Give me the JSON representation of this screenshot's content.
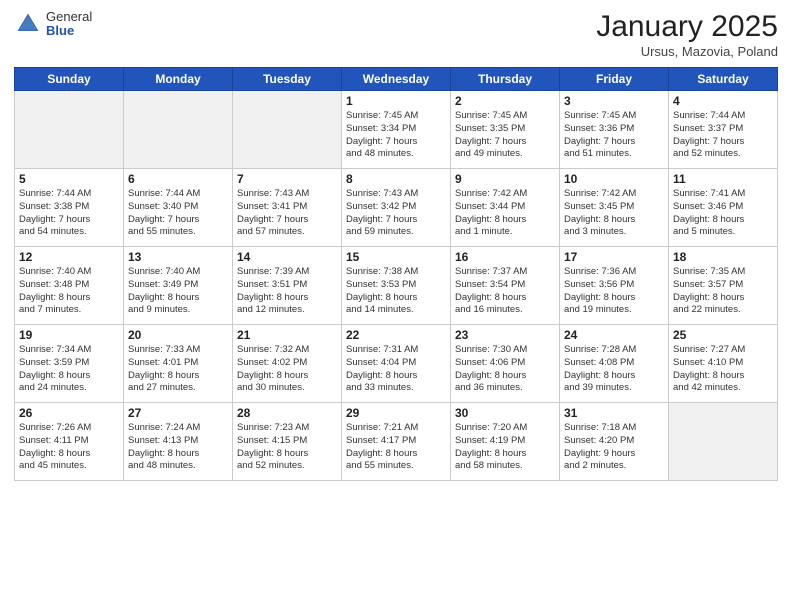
{
  "header": {
    "logo_general": "General",
    "logo_blue": "Blue",
    "month_title": "January 2025",
    "location": "Ursus, Mazovia, Poland"
  },
  "weekdays": [
    "Sunday",
    "Monday",
    "Tuesday",
    "Wednesday",
    "Thursday",
    "Friday",
    "Saturday"
  ],
  "weeks": [
    [
      {
        "day": "",
        "info": ""
      },
      {
        "day": "",
        "info": ""
      },
      {
        "day": "",
        "info": ""
      },
      {
        "day": "1",
        "info": "Sunrise: 7:45 AM\nSunset: 3:34 PM\nDaylight: 7 hours\nand 48 minutes."
      },
      {
        "day": "2",
        "info": "Sunrise: 7:45 AM\nSunset: 3:35 PM\nDaylight: 7 hours\nand 49 minutes."
      },
      {
        "day": "3",
        "info": "Sunrise: 7:45 AM\nSunset: 3:36 PM\nDaylight: 7 hours\nand 51 minutes."
      },
      {
        "day": "4",
        "info": "Sunrise: 7:44 AM\nSunset: 3:37 PM\nDaylight: 7 hours\nand 52 minutes."
      }
    ],
    [
      {
        "day": "5",
        "info": "Sunrise: 7:44 AM\nSunset: 3:38 PM\nDaylight: 7 hours\nand 54 minutes."
      },
      {
        "day": "6",
        "info": "Sunrise: 7:44 AM\nSunset: 3:40 PM\nDaylight: 7 hours\nand 55 minutes."
      },
      {
        "day": "7",
        "info": "Sunrise: 7:43 AM\nSunset: 3:41 PM\nDaylight: 7 hours\nand 57 minutes."
      },
      {
        "day": "8",
        "info": "Sunrise: 7:43 AM\nSunset: 3:42 PM\nDaylight: 7 hours\nand 59 minutes."
      },
      {
        "day": "9",
        "info": "Sunrise: 7:42 AM\nSunset: 3:44 PM\nDaylight: 8 hours\nand 1 minute."
      },
      {
        "day": "10",
        "info": "Sunrise: 7:42 AM\nSunset: 3:45 PM\nDaylight: 8 hours\nand 3 minutes."
      },
      {
        "day": "11",
        "info": "Sunrise: 7:41 AM\nSunset: 3:46 PM\nDaylight: 8 hours\nand 5 minutes."
      }
    ],
    [
      {
        "day": "12",
        "info": "Sunrise: 7:40 AM\nSunset: 3:48 PM\nDaylight: 8 hours\nand 7 minutes."
      },
      {
        "day": "13",
        "info": "Sunrise: 7:40 AM\nSunset: 3:49 PM\nDaylight: 8 hours\nand 9 minutes."
      },
      {
        "day": "14",
        "info": "Sunrise: 7:39 AM\nSunset: 3:51 PM\nDaylight: 8 hours\nand 12 minutes."
      },
      {
        "day": "15",
        "info": "Sunrise: 7:38 AM\nSunset: 3:53 PM\nDaylight: 8 hours\nand 14 minutes."
      },
      {
        "day": "16",
        "info": "Sunrise: 7:37 AM\nSunset: 3:54 PM\nDaylight: 8 hours\nand 16 minutes."
      },
      {
        "day": "17",
        "info": "Sunrise: 7:36 AM\nSunset: 3:56 PM\nDaylight: 8 hours\nand 19 minutes."
      },
      {
        "day": "18",
        "info": "Sunrise: 7:35 AM\nSunset: 3:57 PM\nDaylight: 8 hours\nand 22 minutes."
      }
    ],
    [
      {
        "day": "19",
        "info": "Sunrise: 7:34 AM\nSunset: 3:59 PM\nDaylight: 8 hours\nand 24 minutes."
      },
      {
        "day": "20",
        "info": "Sunrise: 7:33 AM\nSunset: 4:01 PM\nDaylight: 8 hours\nand 27 minutes."
      },
      {
        "day": "21",
        "info": "Sunrise: 7:32 AM\nSunset: 4:02 PM\nDaylight: 8 hours\nand 30 minutes."
      },
      {
        "day": "22",
        "info": "Sunrise: 7:31 AM\nSunset: 4:04 PM\nDaylight: 8 hours\nand 33 minutes."
      },
      {
        "day": "23",
        "info": "Sunrise: 7:30 AM\nSunset: 4:06 PM\nDaylight: 8 hours\nand 36 minutes."
      },
      {
        "day": "24",
        "info": "Sunrise: 7:28 AM\nSunset: 4:08 PM\nDaylight: 8 hours\nand 39 minutes."
      },
      {
        "day": "25",
        "info": "Sunrise: 7:27 AM\nSunset: 4:10 PM\nDaylight: 8 hours\nand 42 minutes."
      }
    ],
    [
      {
        "day": "26",
        "info": "Sunrise: 7:26 AM\nSunset: 4:11 PM\nDaylight: 8 hours\nand 45 minutes."
      },
      {
        "day": "27",
        "info": "Sunrise: 7:24 AM\nSunset: 4:13 PM\nDaylight: 8 hours\nand 48 minutes."
      },
      {
        "day": "28",
        "info": "Sunrise: 7:23 AM\nSunset: 4:15 PM\nDaylight: 8 hours\nand 52 minutes."
      },
      {
        "day": "29",
        "info": "Sunrise: 7:21 AM\nSunset: 4:17 PM\nDaylight: 8 hours\nand 55 minutes."
      },
      {
        "day": "30",
        "info": "Sunrise: 7:20 AM\nSunset: 4:19 PM\nDaylight: 8 hours\nand 58 minutes."
      },
      {
        "day": "31",
        "info": "Sunrise: 7:18 AM\nSunset: 4:20 PM\nDaylight: 9 hours\nand 2 minutes."
      },
      {
        "day": "",
        "info": ""
      }
    ]
  ]
}
